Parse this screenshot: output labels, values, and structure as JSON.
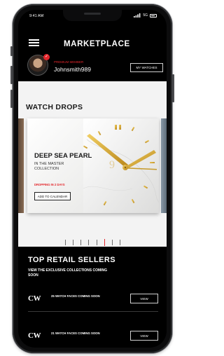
{
  "status_bar": {
    "time": "9:41 AM",
    "network": "5G"
  },
  "header": {
    "title": "MARKETPLACE"
  },
  "profile": {
    "tier": "PREMIUM MEMBER",
    "username": "Johnsmith989",
    "badge_icon": "check-icon",
    "my_watches_label": "MY WATCHES"
  },
  "watch_drops": {
    "title": "WATCH DROPS",
    "card": {
      "title": "DEEP SEA PEARL",
      "subtitle": "IN THE MASTER COLLECTION",
      "drop_time": "DROPPING IN 2 DAYS",
      "button_label": "ADD TO CALENDAR"
    },
    "dial_numeral": "9",
    "page_count": 8,
    "active_page": 5
  },
  "top_sellers": {
    "title": "TOP RETAIL SELLERS",
    "subtitle": "VIEW THE EXCLUSIVE COLLECTIONS COMING SOON",
    "items": [
      {
        "logo": "CW",
        "info": "25 WATCH FACES COMING SOON",
        "button_label": "VIEW"
      },
      {
        "logo": "CW",
        "info": "21 WATCH FACES COMING SOON",
        "button_label": "VIEW"
      }
    ]
  },
  "colors": {
    "accent": "#e3262b",
    "gold": "#d4a52c",
    "background": "#000000"
  }
}
